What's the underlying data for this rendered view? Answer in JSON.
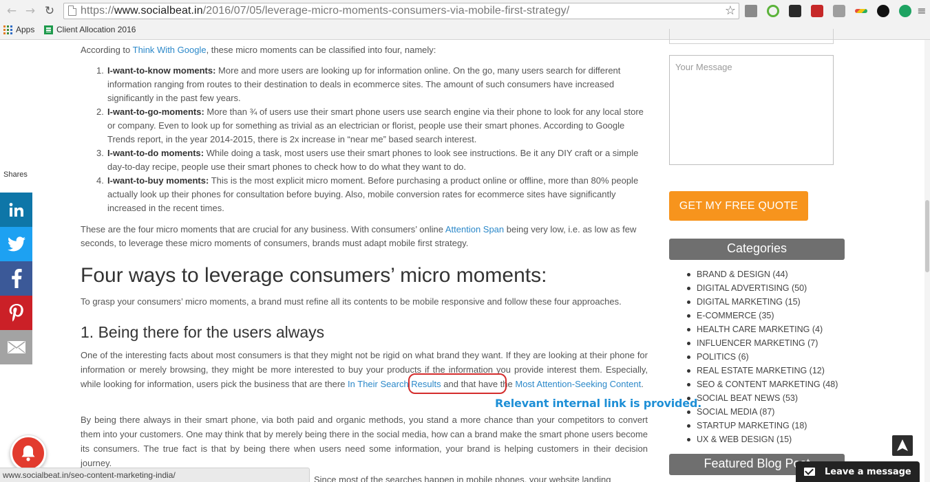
{
  "browser": {
    "url_scheme": "https://",
    "url_host": "www.socialbeat.in",
    "url_path": "/2016/07/05/leverage-micro-moments-consumers-via-mobile-first-strategy/",
    "bookmarks": [
      {
        "label": "Apps"
      },
      {
        "label": "Client Allocation 2016"
      }
    ],
    "status_url": "www.socialbeat.in/seo-content-marketing-india/"
  },
  "share_bar": {
    "label": "Shares",
    "colors": {
      "linkedin": "#0e76a8",
      "twitter": "#1da1f2",
      "facebook": "#3b5998",
      "pinterest": "#cb2027",
      "email": "#a3a3a3"
    }
  },
  "article": {
    "intro_before": "According to ",
    "intro_link": "Think With Google",
    "intro_after": ", these micro moments can be classified into four, namely:",
    "moments": [
      {
        "num": "1.",
        "title": "I-want-to-know moments:",
        "text": " More and more users are looking up for information online. On the go, many users search for different information ranging from routes to their destination to deals in ecommerce sites. The amount of such consumers have increased significantly in the past few years."
      },
      {
        "num": "2.",
        "title": "I-want-to-go-moments:",
        "text": " More than ¾ of users use their smart phone users use search engine via their phone to look for any local store or company. Even to look up for something as trivial as an electrician or florist, people use their smart phones. According to Google Trends report, in the year 2014-2015, there is 2x increase in “near me” based search interest."
      },
      {
        "num": "3.",
        "title": "I-want-to-do moments:",
        "text": " While doing a task, most users use their smart phones to look see instructions. Be it any DIY craft or a simple day-to-day recipe, people use their smart phones to check how to do what they want to do."
      },
      {
        "num": "4.",
        "title": "I-want-to-buy moments:",
        "text": " This is the most explicit micro moment. Before purchasing a product online or offline, more than 80% people actually look up their phones for consultation before buying. Also, mobile conversion rates for ecommerce sites have significantly increased in the recent times."
      }
    ],
    "summary_before": "These are the four micro moments that are crucial for any business. With consumers’ online ",
    "summary_link": "Attention Span",
    "summary_after": " being very low, i.e. as low as few seconds, to leverage these micro moments of consumers, brands must adapt mobile first strategy.",
    "heading": "Four ways to leverage consumers’ micro moments:",
    "heading_intro": "To grasp your consumers’ micro moments, a brand must refine all its contents to be mobile responsive and follow these four approaches.",
    "subheading": "1. Being there for the users always",
    "para1_before": "One of the interesting facts about most consumers is that they might not be rigid on what brand they want. If they are looking at their phone for information or merely browsing, they might be more interested to buy your products if the information you provide interest them. Especially, while looking for information, users pick the business that are there ",
    "para1_link1": "In Their Search Results",
    "para1_middle": " and that have the ",
    "para1_link2": "Most Attention-Seeking Content",
    "para1_after": ".",
    "para2": "By being there always in their smart phone, via both paid and organic methods, you stand a more chance than your competitors to convert them into your customers. One may think that by merely being there in the social media, how can a brand make the smart phone users become its consumers. The true fact is that by being there when users need some information, your brand is helping customers in their decision journey.",
    "para3_partial": "Since most of the searches happen in mobile phones, your website landing",
    "annotation": "Relevant internal link is provided."
  },
  "sidebar": {
    "message_placeholder": "Your Message",
    "quote_button": "GET MY FREE QUOTE",
    "quote_color": "#f7941d",
    "categories_title": "Categories",
    "categories": [
      "BRAND & DESIGN (44)",
      "DIGITAL ADVERTISING (50)",
      "DIGITAL MARKETING (15)",
      "E-COMMERCE (35)",
      "HEALTH CARE MARKETING (4)",
      "INFLUENCER MARKETING (7)",
      "POLITICS (6)",
      "REAL ESTATE MARKETING (12)",
      "SEO & CONTENT MARKETING (48)",
      "SOCIAL BEAT NEWS (53)",
      "SOCIAL MEDIA (87)",
      "STARTUP MARKETING (18)",
      "UX & WEB DESIGN (15)"
    ],
    "featured_title": "Featured Blog Post"
  },
  "widgets": {
    "chat_label": "Leave a message"
  }
}
